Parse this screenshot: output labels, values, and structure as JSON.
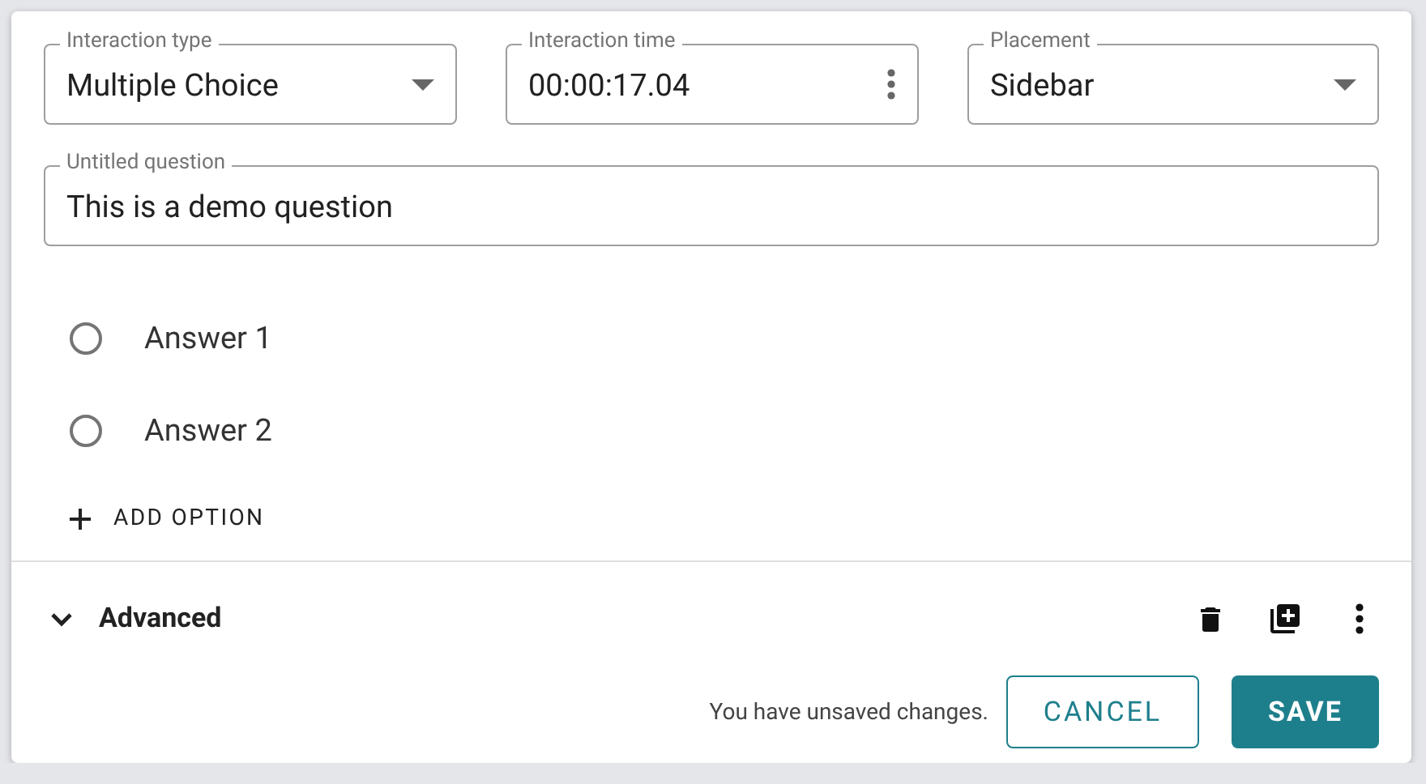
{
  "fields": [
    {
      "kind": "select",
      "label": "Interaction type",
      "value": "Multiple Choice"
    },
    {
      "kind": "menu",
      "label": "Interaction time",
      "value": "00:00:17.04"
    },
    {
      "kind": "select",
      "label": "Placement",
      "value": "Sidebar"
    }
  ],
  "question": {
    "label": "Untitled question",
    "value": "This is a demo question"
  },
  "answers": [
    {
      "label": "Answer 1",
      "selected": false
    },
    {
      "label": "Answer 2",
      "selected": false
    }
  ],
  "add_option": "ADD OPTION",
  "advanced": {
    "title": "Advanced",
    "expanded": false
  },
  "footer": {
    "message": "You have unsaved changes.",
    "cancel": "CANCEL",
    "save": "SAVE"
  }
}
